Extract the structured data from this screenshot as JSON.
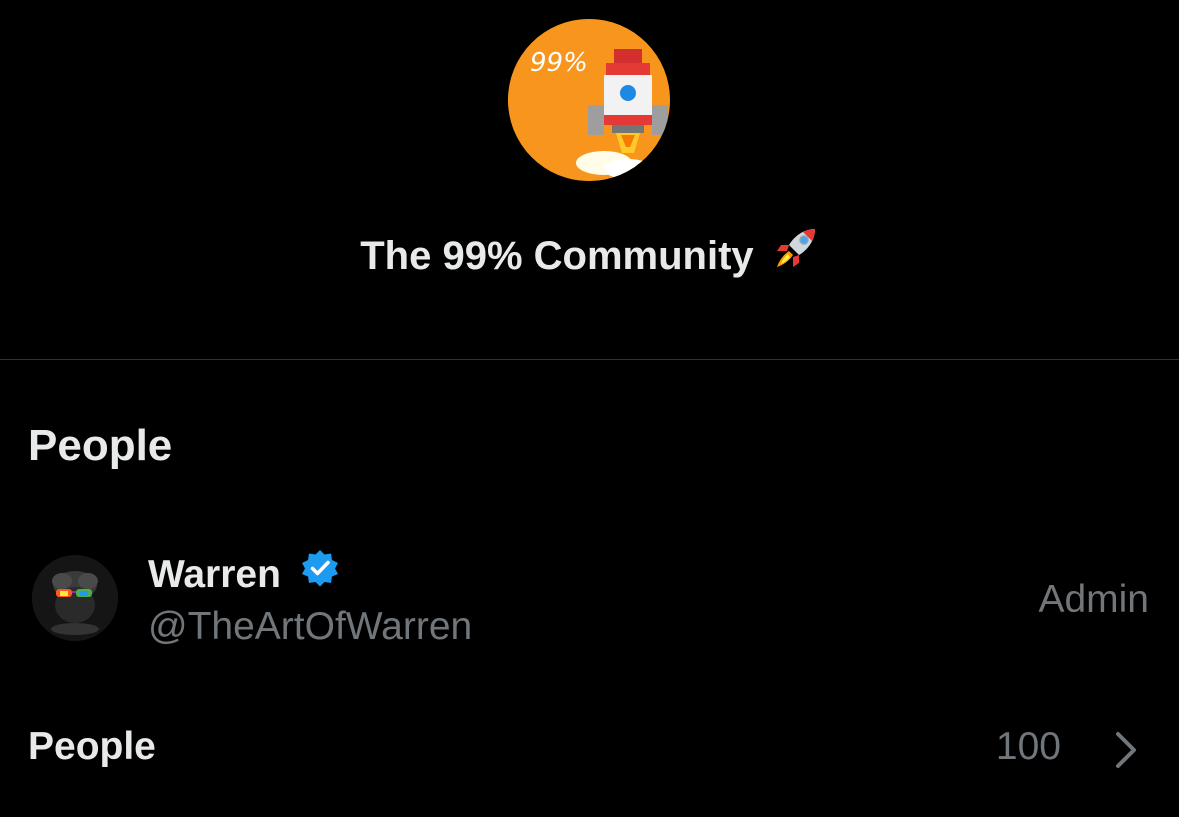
{
  "community": {
    "avatar_text": "99%",
    "avatar_color": "#f7951c",
    "title": "The 99% Community",
    "title_emoji_icon": "rocket-icon"
  },
  "people_section": {
    "heading": "People",
    "members": [
      {
        "name": "Warren",
        "verified": true,
        "verified_icon": "verified-badge-icon",
        "verified_color": "#1d9bf0",
        "handle": "@TheArtOfWarren",
        "role": "Admin"
      }
    ],
    "people_link": {
      "label": "People",
      "count": "100",
      "icon": "chevron-right-icon"
    }
  },
  "colors": {
    "background": "#000000",
    "primary_text": "#e7e9ea",
    "secondary_text": "#71767b",
    "divider": "#2f3336"
  }
}
